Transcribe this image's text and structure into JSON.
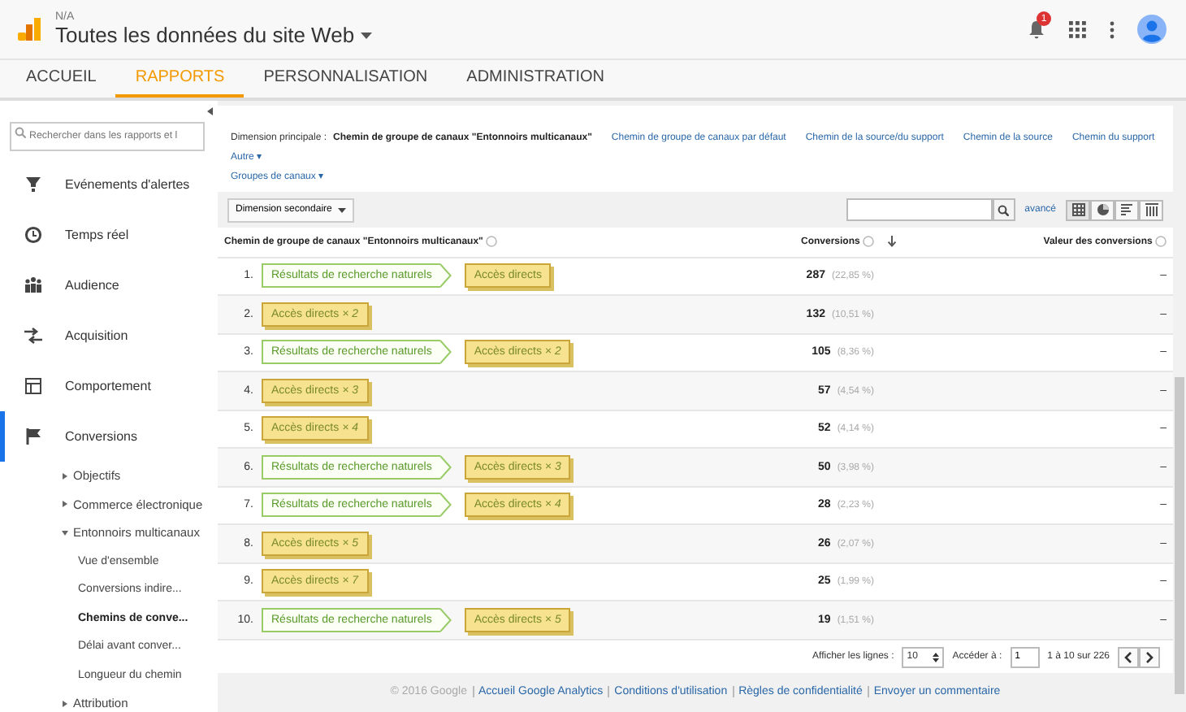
{
  "header": {
    "account": "N/A",
    "property": "Toutes les données du site Web",
    "notifications": "1"
  },
  "tabs": [
    {
      "label": "ACCUEIL",
      "selected": false
    },
    {
      "label": "RAPPORTS",
      "selected": true
    },
    {
      "label": "PERSONNALISATION",
      "selected": false
    },
    {
      "label": "ADMINISTRATION",
      "selected": false
    }
  ],
  "sidebar": {
    "search": {
      "placeholder": "Rechercher dans les rapports et l"
    },
    "items": [
      {
        "label": "Evénements d'alertes",
        "selected": false
      },
      {
        "label": "Temps réel",
        "selected": false
      },
      {
        "label": "Audience",
        "selected": false
      },
      {
        "label": "Acquisition",
        "selected": false
      },
      {
        "label": "Comportement",
        "selected": false
      },
      {
        "label": "Conversions",
        "selected": true,
        "children": [
          {
            "label": "Objectifs",
            "expanded": false
          },
          {
            "label": "Commerce électronique",
            "expanded": false
          },
          {
            "label": "Entonnoirs multicanaux",
            "expanded": true,
            "children": [
              {
                "label": "Vue d'ensemble",
                "selected": false
              },
              {
                "label": "Conversions indire...",
                "selected": false
              },
              {
                "label": "Chemins de conve...",
                "selected": true
              },
              {
                "label": "Délai avant conver...",
                "selected": false
              },
              {
                "label": "Longueur du chemin",
                "selected": false
              }
            ]
          },
          {
            "label": "Attribution",
            "expanded": false
          }
        ]
      }
    ]
  },
  "dimensions": {
    "label": "Dimension principale :",
    "options": [
      {
        "label": "Chemin de groupe de canaux \"Entonnoirs multicanaux\"",
        "selected": true
      },
      {
        "label": "Chemin de groupe de canaux par défaut",
        "selected": false
      },
      {
        "label": "Chemin de la source/du support",
        "selected": false
      },
      {
        "label": "Chemin de la source",
        "selected": false
      },
      {
        "label": "Chemin du support",
        "selected": false
      }
    ],
    "menus": [
      "Autre ▾",
      "Groupes de canaux ▾"
    ]
  },
  "toolbar": {
    "secondary_dimension": "Dimension secondaire",
    "advanced": "avancé"
  },
  "table": {
    "columns": [
      "Chemin de groupe de canaux \"Entonnoirs multicanaux\"",
      "Conversions",
      "Valeur des conversions"
    ],
    "rows": [
      {
        "index": "1.",
        "path": [
          {
            "kind": "organic",
            "label": "Résultats de recherche naturels"
          },
          {
            "kind": "direct",
            "label": "Accès directs"
          }
        ],
        "conversions": "287",
        "share": "(22,85 %)",
        "value": "–"
      },
      {
        "index": "2.",
        "path": [
          {
            "kind": "direct",
            "label": "Accès directs *× 2*"
          }
        ],
        "conversions": "132",
        "share": "(10,51 %)",
        "value": "–"
      },
      {
        "index": "3.",
        "path": [
          {
            "kind": "organic",
            "label": "Résultats de recherche naturels"
          },
          {
            "kind": "direct",
            "label": "Accès directs *× 2*"
          }
        ],
        "conversions": "105",
        "share": "(8,36 %)",
        "value": "–"
      },
      {
        "index": "4.",
        "path": [
          {
            "kind": "direct",
            "label": "Accès directs *× 3*"
          }
        ],
        "conversions": "57",
        "share": "(4,54 %)",
        "value": "–"
      },
      {
        "index": "5.",
        "path": [
          {
            "kind": "direct",
            "label": "Accès directs *× 4*"
          }
        ],
        "conversions": "52",
        "share": "(4,14 %)",
        "value": "–"
      },
      {
        "index": "6.",
        "path": [
          {
            "kind": "organic",
            "label": "Résultats de recherche naturels"
          },
          {
            "kind": "direct",
            "label": "Accès directs *× 3*"
          }
        ],
        "conversions": "50",
        "share": "(3,98 %)",
        "value": "–"
      },
      {
        "index": "7.",
        "path": [
          {
            "kind": "organic",
            "label": "Résultats de recherche naturels"
          },
          {
            "kind": "direct",
            "label": "Accès directs *× 4*"
          }
        ],
        "conversions": "28",
        "share": "(2,23 %)",
        "value": "–"
      },
      {
        "index": "8.",
        "path": [
          {
            "kind": "direct",
            "label": "Accès directs *× 5*"
          }
        ],
        "conversions": "26",
        "share": "(2,07 %)",
        "value": "–"
      },
      {
        "index": "9.",
        "path": [
          {
            "kind": "direct",
            "label": "Accès directs *× 7*"
          }
        ],
        "conversions": "25",
        "share": "(1,99 %)",
        "value": "–"
      },
      {
        "index": "10.",
        "path": [
          {
            "kind": "organic",
            "label": "Résultats de recherche naturels"
          },
          {
            "kind": "direct",
            "label": "Accès directs *× 5*"
          }
        ],
        "conversions": "19",
        "share": "(1,51 %)",
        "value": "–"
      }
    ]
  },
  "pagination": {
    "rows_label": "Afficher les lignes :",
    "rows_value": "10",
    "goto_label": "Accéder à :",
    "goto_value": "1",
    "range": "1 à 10 sur 226"
  },
  "footer": {
    "copyright": "© 2016 Google",
    "links": [
      "Accueil Google Analytics",
      "Conditions d'utilisation",
      "Règles de confidentialité",
      "Envoyer un commentaire"
    ]
  }
}
